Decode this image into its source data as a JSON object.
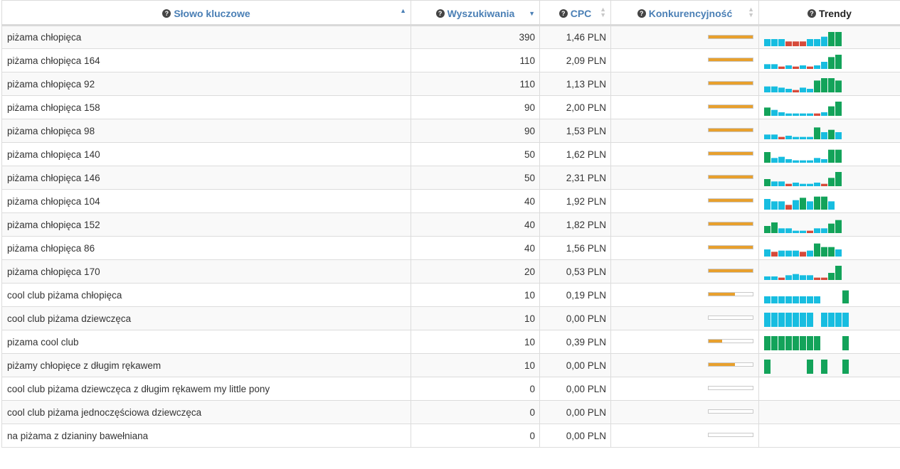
{
  "columns": {
    "keyword": "Słowo kluczowe",
    "searches": "Wyszukiwania",
    "cpc": "CPC",
    "competition": "Konkurencyjność",
    "trends": "Trendy"
  },
  "help_icon": "question-circle-icon",
  "sort_state": {
    "keyword": "asc",
    "searches": "desc"
  },
  "colors": {
    "up": "#13a35a",
    "neutral": "#17bde0",
    "down": "#d64a3a",
    "competition": "#e8a02d"
  },
  "rows": [
    {
      "keyword": "piżama chłopięca",
      "searches": "390",
      "cpc": "1,46 PLN",
      "competition": 1.0,
      "trend": [
        [
          3,
          "n"
        ],
        [
          3,
          "n"
        ],
        [
          3,
          "n"
        ],
        [
          2,
          "d"
        ],
        [
          2,
          "d"
        ],
        [
          2,
          "d"
        ],
        [
          3,
          "n"
        ],
        [
          3,
          "n"
        ],
        [
          4,
          "n"
        ],
        [
          6,
          "u"
        ],
        [
          6,
          "u"
        ]
      ]
    },
    {
      "keyword": "piżama chłopięca 164",
      "searches": "110",
      "cpc": "2,09 PLN",
      "competition": 1.0,
      "trend": [
        [
          2,
          "n"
        ],
        [
          2,
          "n"
        ],
        [
          1,
          "d"
        ],
        [
          1.5,
          "n"
        ],
        [
          1,
          "d"
        ],
        [
          1.5,
          "n"
        ],
        [
          1,
          "d"
        ],
        [
          1.5,
          "n"
        ],
        [
          3,
          "n"
        ],
        [
          5,
          "u"
        ],
        [
          6,
          "u"
        ]
      ]
    },
    {
      "keyword": "piżama chłopięca 92",
      "searches": "110",
      "cpc": "1,13 PLN",
      "competition": 1.0,
      "trend": [
        [
          2.5,
          "n"
        ],
        [
          2.5,
          "n"
        ],
        [
          2,
          "n"
        ],
        [
          1.5,
          "n"
        ],
        [
          1,
          "d"
        ],
        [
          2,
          "n"
        ],
        [
          1.5,
          "n"
        ],
        [
          5,
          "u"
        ],
        [
          6,
          "u"
        ],
        [
          6,
          "u"
        ],
        [
          5,
          "u"
        ]
      ]
    },
    {
      "keyword": "piżama chłopięca 158",
      "searches": "90",
      "cpc": "2,00 PLN",
      "competition": 1.0,
      "trend": [
        [
          3.5,
          "u"
        ],
        [
          2.5,
          "n"
        ],
        [
          1.5,
          "n"
        ],
        [
          1,
          "n"
        ],
        [
          1,
          "n"
        ],
        [
          1,
          "n"
        ],
        [
          1,
          "n"
        ],
        [
          1,
          "d"
        ],
        [
          1.5,
          "n"
        ],
        [
          4,
          "u"
        ],
        [
          6,
          "u"
        ]
      ]
    },
    {
      "keyword": "piżama chłopięca 98",
      "searches": "90",
      "cpc": "1,53 PLN",
      "competition": 1.0,
      "trend": [
        [
          2,
          "n"
        ],
        [
          2,
          "n"
        ],
        [
          1,
          "d"
        ],
        [
          1.5,
          "n"
        ],
        [
          1,
          "n"
        ],
        [
          1,
          "n"
        ],
        [
          1,
          "n"
        ],
        [
          5,
          "u"
        ],
        [
          3,
          "n"
        ],
        [
          4,
          "u"
        ],
        [
          3,
          "n"
        ]
      ]
    },
    {
      "keyword": "piżama chłopięca 140",
      "searches": "50",
      "cpc": "1,62 PLN",
      "competition": 1.0,
      "trend": [
        [
          4.5,
          "u"
        ],
        [
          2,
          "n"
        ],
        [
          2.5,
          "n"
        ],
        [
          1.5,
          "n"
        ],
        [
          1,
          "n"
        ],
        [
          1,
          "n"
        ],
        [
          1,
          "n"
        ],
        [
          2,
          "n"
        ],
        [
          1.5,
          "n"
        ],
        [
          5.5,
          "u"
        ],
        [
          5.5,
          "u"
        ]
      ]
    },
    {
      "keyword": "piżama chłopięca 146",
      "searches": "50",
      "cpc": "2,31 PLN",
      "competition": 1.0,
      "trend": [
        [
          3,
          "u"
        ],
        [
          2,
          "n"
        ],
        [
          2,
          "n"
        ],
        [
          1,
          "d"
        ],
        [
          1.5,
          "n"
        ],
        [
          1,
          "n"
        ],
        [
          1,
          "n"
        ],
        [
          1.5,
          "n"
        ],
        [
          1,
          "d"
        ],
        [
          3.5,
          "u"
        ],
        [
          6,
          "u"
        ]
      ]
    },
    {
      "keyword": "piżama chłopięca 104",
      "searches": "40",
      "cpc": "1,92 PLN",
      "competition": 1.0,
      "trend": [
        [
          4.5,
          "n"
        ],
        [
          3.5,
          "n"
        ],
        [
          3.5,
          "n"
        ],
        [
          2,
          "d"
        ],
        [
          4,
          "n"
        ],
        [
          5,
          "u"
        ],
        [
          3.5,
          "n"
        ],
        [
          5.5,
          "u"
        ],
        [
          5.5,
          "u"
        ],
        [
          3.5,
          "n"
        ]
      ]
    },
    {
      "keyword": "piżama chłopięca 152",
      "searches": "40",
      "cpc": "1,82 PLN",
      "competition": 1.0,
      "trend": [
        [
          3,
          "u"
        ],
        [
          4.5,
          "u"
        ],
        [
          2,
          "n"
        ],
        [
          2,
          "n"
        ],
        [
          1,
          "n"
        ],
        [
          1,
          "n"
        ],
        [
          1,
          "d"
        ],
        [
          2,
          "n"
        ],
        [
          2,
          "n"
        ],
        [
          4,
          "u"
        ],
        [
          5.5,
          "u"
        ]
      ]
    },
    {
      "keyword": "piżama chłopięca 86",
      "searches": "40",
      "cpc": "1,56 PLN",
      "competition": 1.0,
      "trend": [
        [
          3,
          "n"
        ],
        [
          2,
          "d"
        ],
        [
          2.5,
          "n"
        ],
        [
          2.5,
          "n"
        ],
        [
          2.5,
          "n"
        ],
        [
          2,
          "d"
        ],
        [
          2.5,
          "n"
        ],
        [
          5.5,
          "u"
        ],
        [
          4,
          "u"
        ],
        [
          4,
          "u"
        ],
        [
          3,
          "n"
        ]
      ]
    },
    {
      "keyword": "piżama chłopięca 170",
      "searches": "20",
      "cpc": "0,53 PLN",
      "competition": 1.0,
      "trend": [
        [
          1.5,
          "n"
        ],
        [
          1.5,
          "n"
        ],
        [
          1,
          "d"
        ],
        [
          2,
          "n"
        ],
        [
          2.5,
          "n"
        ],
        [
          2,
          "n"
        ],
        [
          2,
          "n"
        ],
        [
          1,
          "d"
        ],
        [
          1,
          "d"
        ],
        [
          3,
          "u"
        ],
        [
          6,
          "u"
        ]
      ]
    },
    {
      "keyword": "cool club piżama chłopięca",
      "searches": "10",
      "cpc": "0,19 PLN",
      "competition": 0.6,
      "trend": [
        [
          3,
          "n"
        ],
        [
          3,
          "n"
        ],
        [
          3,
          "n"
        ],
        [
          3,
          "n"
        ],
        [
          3,
          "n"
        ],
        [
          3,
          "n"
        ],
        [
          3,
          "n"
        ],
        [
          3,
          "n"
        ],
        null,
        null,
        null,
        [
          5.5,
          "u"
        ]
      ]
    },
    {
      "keyword": "cool club piżama dziewczęca",
      "searches": "10",
      "cpc": "0,00 PLN",
      "competition": 0,
      "trend": [
        [
          6,
          "n"
        ],
        [
          6,
          "n"
        ],
        [
          6,
          "n"
        ],
        [
          6,
          "n"
        ],
        [
          6,
          "n"
        ],
        [
          6,
          "n"
        ],
        [
          6,
          "n"
        ],
        null,
        [
          6,
          "n"
        ],
        [
          6,
          "n"
        ],
        [
          6,
          "n"
        ],
        [
          6,
          "n"
        ]
      ]
    },
    {
      "keyword": "pizama cool club",
      "searches": "10",
      "cpc": "0,39 PLN",
      "competition": 0.3,
      "trend": [
        [
          6,
          "u"
        ],
        [
          6,
          "u"
        ],
        [
          6,
          "u"
        ],
        [
          6,
          "u"
        ],
        [
          6,
          "u"
        ],
        [
          6,
          "u"
        ],
        [
          6,
          "u"
        ],
        [
          6,
          "u"
        ],
        null,
        null,
        null,
        [
          6,
          "u"
        ]
      ]
    },
    {
      "keyword": "piżamy chłopięce z długim rękawem",
      "searches": "10",
      "cpc": "0,00 PLN",
      "competition": 0.6,
      "trend": [
        [
          6,
          "u"
        ],
        null,
        null,
        null,
        null,
        null,
        [
          6,
          "u"
        ],
        null,
        [
          6,
          "u"
        ],
        null,
        null,
        [
          6,
          "u"
        ]
      ]
    },
    {
      "keyword": "cool club piżama dziewczęca z długim rękawem my little pony",
      "searches": "0",
      "cpc": "0,00 PLN",
      "competition": 0,
      "trend": []
    },
    {
      "keyword": "cool club piżama jednoczęściowa dziewczęca",
      "searches": "0",
      "cpc": "0,00 PLN",
      "competition": 0,
      "trend": []
    },
    {
      "keyword": "na piżama z dzianiny bawełniana",
      "searches": "0",
      "cpc": "0,00 PLN",
      "competition": 0,
      "trend": []
    }
  ]
}
